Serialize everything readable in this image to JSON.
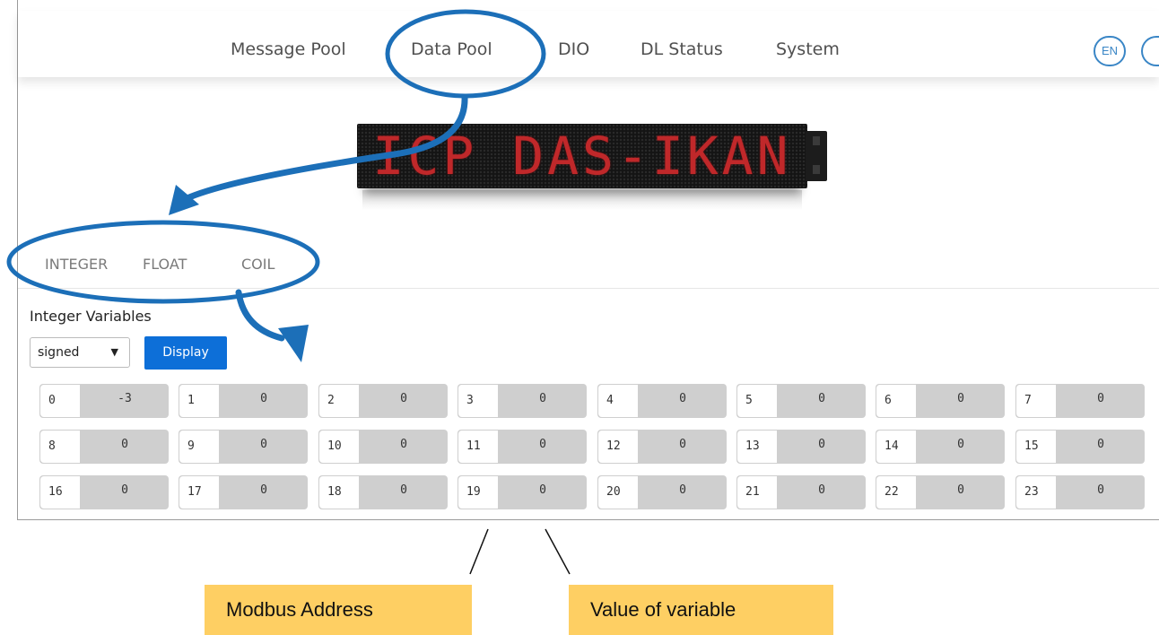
{
  "nav": {
    "items": [
      "Message Pool",
      "Data Pool",
      "DIO",
      "DL Status",
      "System"
    ],
    "lang_en": "EN"
  },
  "banner": {
    "text": "ICP DAS-IKAN"
  },
  "tabs": [
    "INTEGER",
    "FLOAT",
    "COIL"
  ],
  "section": {
    "title": "Integer Variables",
    "select_value": "signed",
    "display_label": "Display"
  },
  "variables": [
    {
      "address": "0",
      "value": "-3"
    },
    {
      "address": "1",
      "value": "0"
    },
    {
      "address": "2",
      "value": "0"
    },
    {
      "address": "3",
      "value": "0"
    },
    {
      "address": "4",
      "value": "0"
    },
    {
      "address": "5",
      "value": "0"
    },
    {
      "address": "6",
      "value": "0"
    },
    {
      "address": "7",
      "value": "0"
    },
    {
      "address": "8",
      "value": "0"
    },
    {
      "address": "9",
      "value": "0"
    },
    {
      "address": "10",
      "value": "0"
    },
    {
      "address": "11",
      "value": "0"
    },
    {
      "address": "12",
      "value": "0"
    },
    {
      "address": "13",
      "value": "0"
    },
    {
      "address": "14",
      "value": "0"
    },
    {
      "address": "15",
      "value": "0"
    },
    {
      "address": "16",
      "value": "0"
    },
    {
      "address": "17",
      "value": "0"
    },
    {
      "address": "18",
      "value": "0"
    },
    {
      "address": "19",
      "value": "0"
    },
    {
      "address": "20",
      "value": "0"
    },
    {
      "address": "21",
      "value": "0"
    },
    {
      "address": "22",
      "value": "0"
    },
    {
      "address": "23",
      "value": "0"
    }
  ],
  "annotations": {
    "modbus_address": "Modbus Address",
    "value_of_variable": "Value of variable"
  },
  "colors": {
    "accent": "#0d6fd8",
    "annotation_blue": "#1c6fb8",
    "callout_bg": "#fecf63",
    "led_red": "#c0282a"
  }
}
